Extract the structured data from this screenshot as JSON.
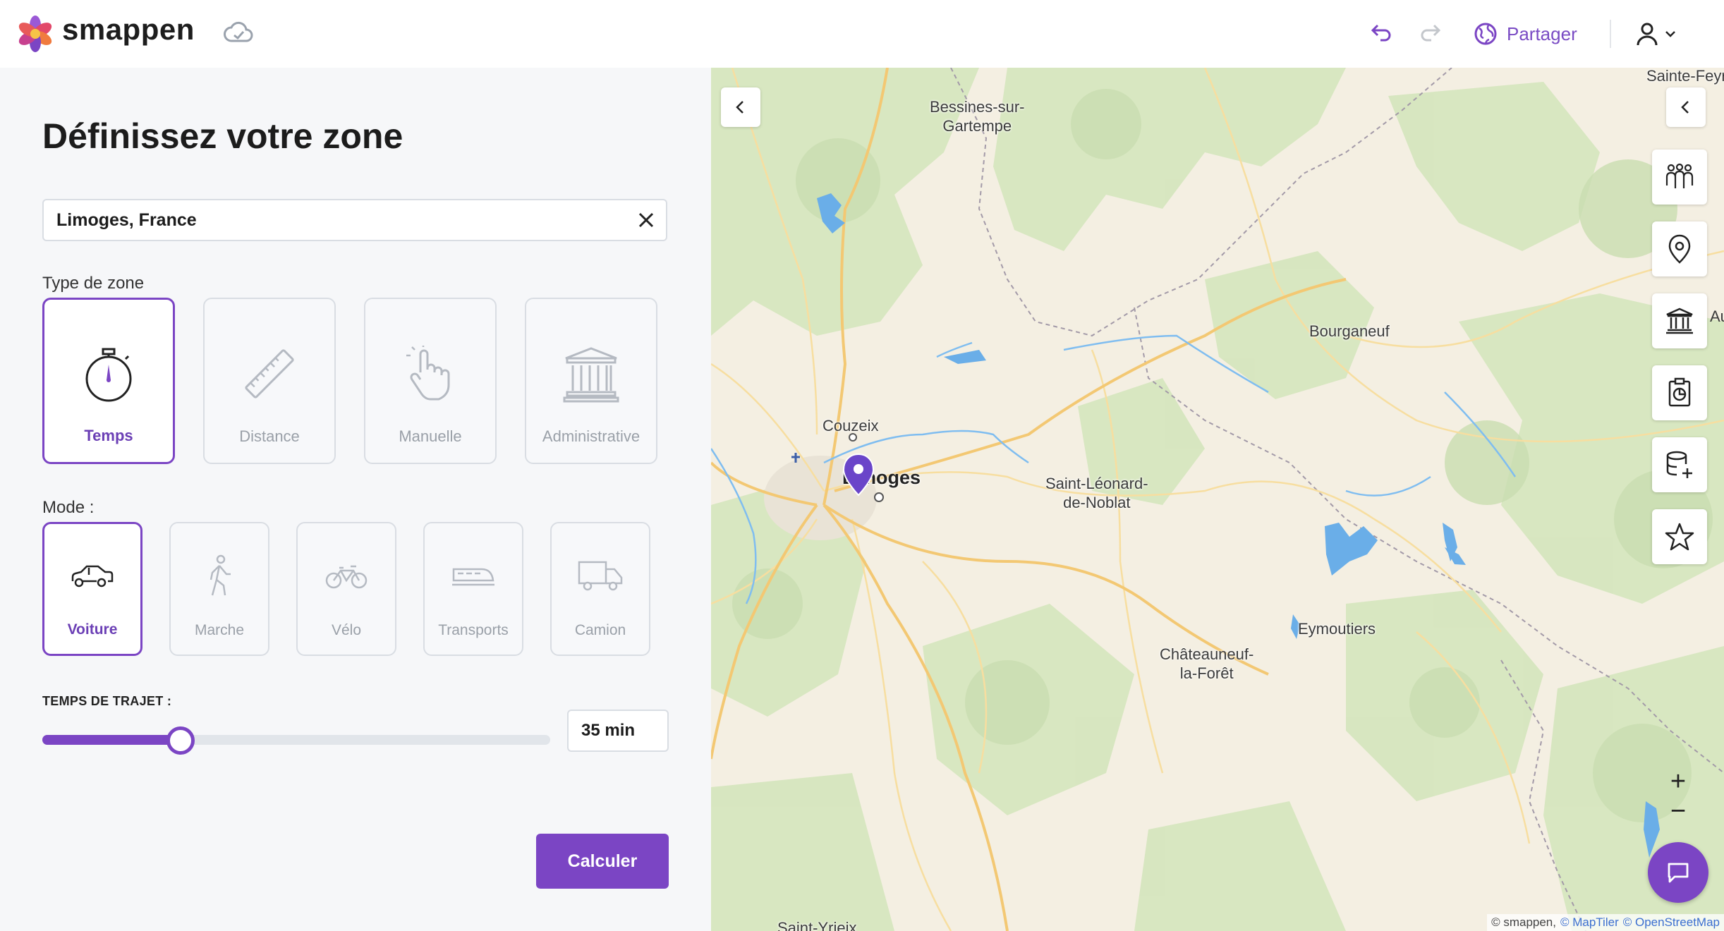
{
  "header": {
    "brand": "smappen",
    "share_label": "Partager",
    "icons": [
      "flower-logo-icon",
      "cloud-sync-icon",
      "undo-icon",
      "redo-icon",
      "globe-icon",
      "user-icon",
      "chevron-down-icon"
    ]
  },
  "panel": {
    "title": "Définissez votre zone",
    "search": {
      "value": "Limoges, France",
      "placeholder": ""
    },
    "zone_type_label": "Type de zone",
    "zone_types": [
      {
        "label": "Temps",
        "icon": "stopwatch-icon",
        "active": true
      },
      {
        "label": "Distance",
        "icon": "ruler-icon",
        "active": false
      },
      {
        "label": "Manuelle",
        "icon": "hand-pointer-icon",
        "active": false
      },
      {
        "label": "Administrative",
        "icon": "institution-icon",
        "active": false
      }
    ],
    "mode_label": "Mode :",
    "modes": [
      {
        "label": "Voiture",
        "icon": "car-icon",
        "active": true
      },
      {
        "label": "Marche",
        "icon": "walking-icon",
        "active": false
      },
      {
        "label": "Vélo",
        "icon": "bicycle-icon",
        "active": false
      },
      {
        "label": "Transports",
        "icon": "train-icon",
        "active": false
      },
      {
        "label": "Camion",
        "icon": "truck-icon",
        "active": false
      }
    ],
    "travel_time_label": "TEMPS DE TRAJET :",
    "travel_time_fraction": 0.272,
    "travel_time_value": "35 min",
    "calculate_label": "Calculer"
  },
  "map": {
    "places": [
      {
        "name": "Sainte-Feyre",
        "big": false
      },
      {
        "name": "Bessines-sur-\nGartempe",
        "big": false
      },
      {
        "name": "Bourganeuf",
        "big": false
      },
      {
        "name": "Couzeix",
        "big": false
      },
      {
        "name": "Limoges",
        "big": true
      },
      {
        "name": "Saint-Léonard-\nde-Noblat",
        "big": false
      },
      {
        "name": "Eymoutiers",
        "big": false
      },
      {
        "name": "Châteauneuf-\nla-Forêt",
        "big": false
      },
      {
        "name": "Saint-Yrieix",
        "big": false
      }
    ],
    "edge_label": "Au",
    "tools": [
      "population-icon",
      "location-pin-icon",
      "institution-icon",
      "clipboard-chart-icon",
      "database-add-icon",
      "star-icon"
    ],
    "zoom_in": "+",
    "zoom_out": "−",
    "attribution": {
      "prefix": "© smappen,",
      "maptiler": "© MapTiler",
      "osm": "© OpenStreetMap"
    },
    "colors": {
      "accent": "#7b45c4",
      "road_major": "#f3c873",
      "water": "#6aaee8",
      "forest": "#d6e6bf",
      "land": "#f4efe2"
    }
  }
}
